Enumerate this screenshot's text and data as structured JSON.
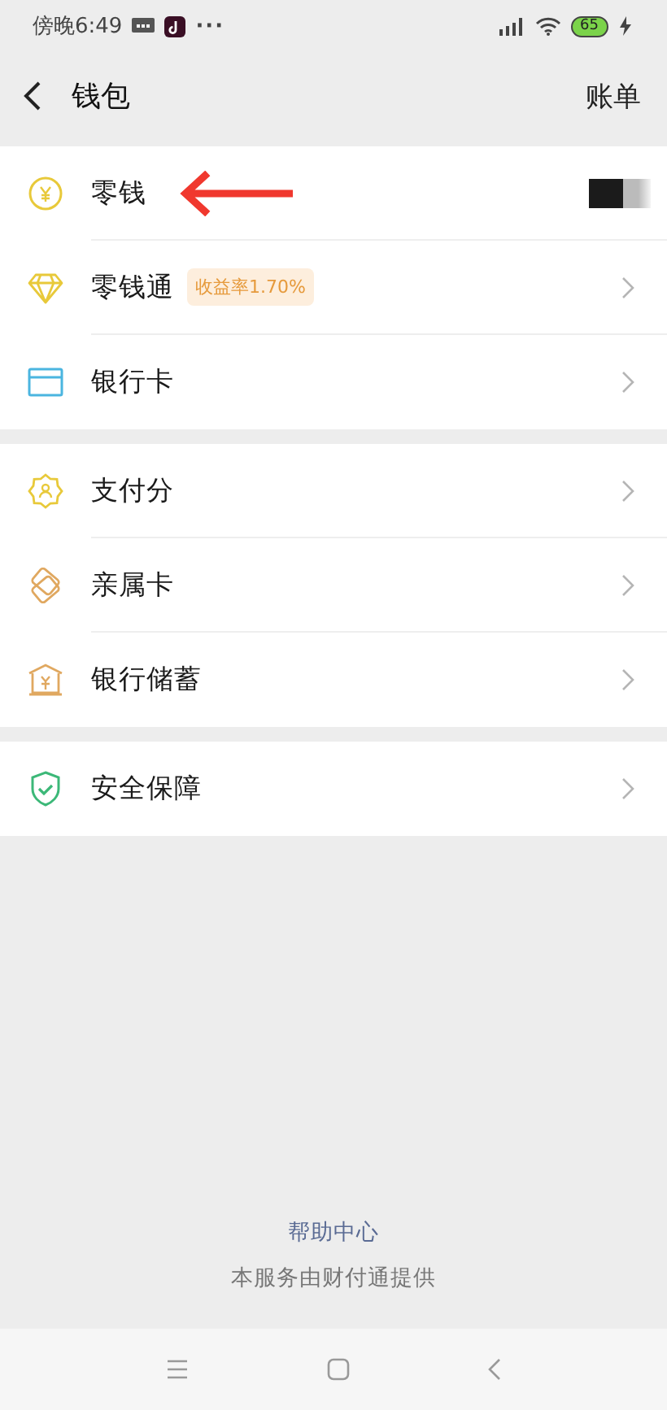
{
  "status_bar": {
    "time": "傍晚6:49",
    "more": "···",
    "battery": "65"
  },
  "header": {
    "title": "钱包",
    "action": "账单"
  },
  "groups": [
    {
      "items": [
        {
          "label": "零钱",
          "redacted": true,
          "chevron": false,
          "arrow_annotation": true
        },
        {
          "label": "零钱通",
          "badge": "收益率1.70%",
          "chevron": true
        },
        {
          "label": "银行卡",
          "chevron": true
        }
      ]
    },
    {
      "items": [
        {
          "label": "支付分",
          "chevron": true
        },
        {
          "label": "亲属卡",
          "chevron": true
        },
        {
          "label": "银行储蓄",
          "chevron": true
        }
      ]
    },
    {
      "items": [
        {
          "label": "安全保障",
          "chevron": true
        }
      ]
    }
  ],
  "footer": {
    "help": "帮助中心",
    "provider": "本服务由财付通提供"
  }
}
